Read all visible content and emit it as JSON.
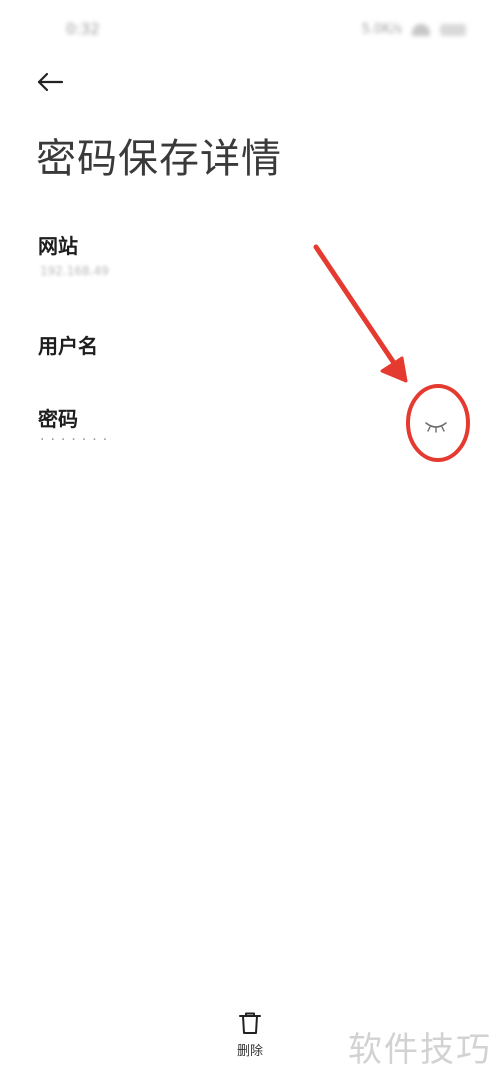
{
  "status_bar": {
    "time": "0:32",
    "network_speed": "5.0K/s"
  },
  "page": {
    "title": "密码保存详情"
  },
  "fields": {
    "website": {
      "label": "网站",
      "value": "192.168.49"
    },
    "username": {
      "label": "用户名"
    },
    "password": {
      "label": "密码",
      "value": "·······",
      "toggle_icon": "eye-closed-icon"
    }
  },
  "bottom_bar": {
    "delete_label": "删除",
    "delete_icon": "trash-icon"
  },
  "watermark": {
    "text": "软件技巧"
  },
  "colors": {
    "annotation_red": "#e53a2f",
    "title_gray": "#3a3a3a"
  }
}
